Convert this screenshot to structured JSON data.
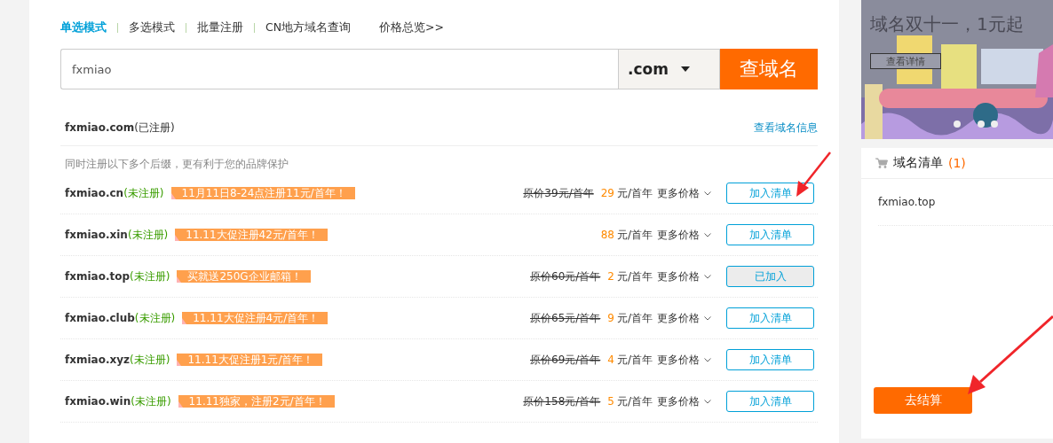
{
  "nav": {
    "tabs": [
      {
        "label": "单选模式",
        "selected": true
      },
      {
        "label": "多选模式",
        "selected": false
      },
      {
        "label": "批量注册",
        "selected": false
      },
      {
        "label": "CN地方域名查询",
        "selected": false
      }
    ],
    "price_link": "价格总览>>"
  },
  "search": {
    "value": "fxmiao",
    "suffix": ".com",
    "button": "查域名"
  },
  "registered": {
    "domain": "fxmiao.com",
    "status": "(已注册)",
    "link": "查看域名信息"
  },
  "hint": "同时注册以下多个后缀，更有利于您的品牌保护",
  "results": [
    {
      "domain": "fxmiao.cn",
      "status": "(未注册)",
      "promo": "11月11日8-24点注册11元/首年！",
      "original_price": "原价39元/首年",
      "price": "29",
      "unit": "元/首年",
      "more": "更多价格",
      "button": "加入清单",
      "added": false
    },
    {
      "domain": "fxmiao.xin",
      "status": "(未注册)",
      "promo": "11.11大促注册42元/首年！",
      "price": "88",
      "unit": "元/首年",
      "more": "更多价格",
      "button": "加入清单",
      "added": false
    },
    {
      "domain": "fxmiao.top",
      "status": "(未注册)",
      "promo": "买就送250G企业邮箱！",
      "original_price": "原价60元/首年",
      "price": "2",
      "unit": "元/首年",
      "more": "更多价格",
      "button": "已加入",
      "added": true
    },
    {
      "domain": "fxmiao.club",
      "status": "(未注册)",
      "promo": "11.11大促注册4元/首年！",
      "original_price": "原价65元/首年",
      "price": "9",
      "unit": "元/首年",
      "more": "更多价格",
      "button": "加入清单",
      "added": false
    },
    {
      "domain": "fxmiao.xyz",
      "status": "(未注册)",
      "promo": "11.11大促注册1元/首年！",
      "original_price": "原价69元/首年",
      "price": "4",
      "unit": "元/首年",
      "more": "更多价格",
      "button": "加入清单",
      "added": false
    },
    {
      "domain": "fxmiao.win",
      "status": "(未注册)",
      "promo": "11.11独家，注册2元/首年！",
      "original_price": "原价158元/首年",
      "price": "5",
      "unit": "元/首年",
      "more": "更多价格",
      "button": "加入清单",
      "added": false
    }
  ],
  "banner": {
    "headline": "域名双十一，1元起",
    "button": "查看详情"
  },
  "cart": {
    "title": "域名清单",
    "count": "(1)",
    "items": [
      "fxmiao.top"
    ],
    "checkout": "去结算"
  }
}
